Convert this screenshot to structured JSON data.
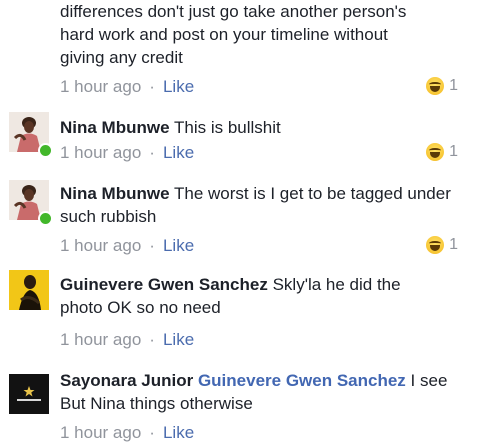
{
  "partial_comment": {
    "lines": [
      "differences don't just go take another person's",
      "hard work and post on your timeline without",
      "giving any credit"
    ],
    "time": "1 hour ago",
    "like_label": "Like",
    "reaction_count": "1",
    "reaction_icon": "haha-emoji-icon"
  },
  "comments": [
    {
      "author": "Nina Mbunwe",
      "text": "This is bullshit",
      "time": "1 hour ago",
      "like_label": "Like",
      "reaction_count": "1",
      "online": true
    },
    {
      "author": "Nina Mbunwe",
      "text": "The worst is I get to be tagged under such rubbish",
      "time": "1 hour ago",
      "like_label": "Like",
      "reaction_count": "1",
      "online": true
    },
    {
      "author": "Guinevere Gwen Sanchez",
      "text": "Skly'la he did the photo OK so no need",
      "time": "1 hour ago",
      "like_label": "Like"
    },
    {
      "author": "Sayonara Junior",
      "mention": "Guinevere Gwen Sanchez",
      "text": "I see But Nina things otherwise",
      "time": "1 hour ago",
      "like_label": "Like"
    }
  ],
  "separator": "·",
  "colors": {
    "link": "#4267b2",
    "meta": "#90949c",
    "online": "#42b72a"
  }
}
